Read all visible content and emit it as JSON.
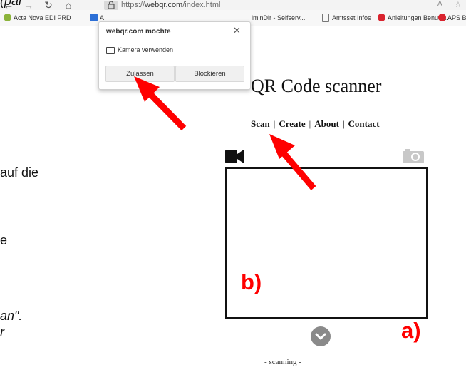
{
  "doc_fragments": {
    "top": "(par",
    "line1": "auf die",
    "line2": "e",
    "line3": "an\".",
    "line4": "r"
  },
  "browser": {
    "url_prefix": "https://",
    "url_host": "webqr.com",
    "url_path": "/index.html",
    "read_aloud": "A",
    "bookmarks": [
      {
        "label": "Acta Nova EDI PRD",
        "icon_color": "#8bb33a"
      },
      {
        "label": "A",
        "icon_color": "#2c6fd6"
      },
      {
        "label": "lminDir - Selfserv...",
        "icon_color": ""
      },
      {
        "label": "Amtsset Infos",
        "icon_color": "#777777"
      },
      {
        "label": "Anleitungen Benutz...",
        "icon_color": "#d9232e"
      },
      {
        "label": "APS Bi",
        "icon_color": "#d9232e"
      }
    ]
  },
  "popup": {
    "title": "webqr.com möchte",
    "permission": "Kamera verwenden",
    "allow": "Zulassen",
    "block": "Blockieren"
  },
  "page": {
    "title": "QR Code scanner",
    "menu": [
      "Scan",
      "Create",
      "About",
      "Contact"
    ],
    "result_text": "- scanning -"
  },
  "annotations": {
    "label_a": "a)",
    "label_b": "b)",
    "arrow_color": "#ff0000"
  }
}
